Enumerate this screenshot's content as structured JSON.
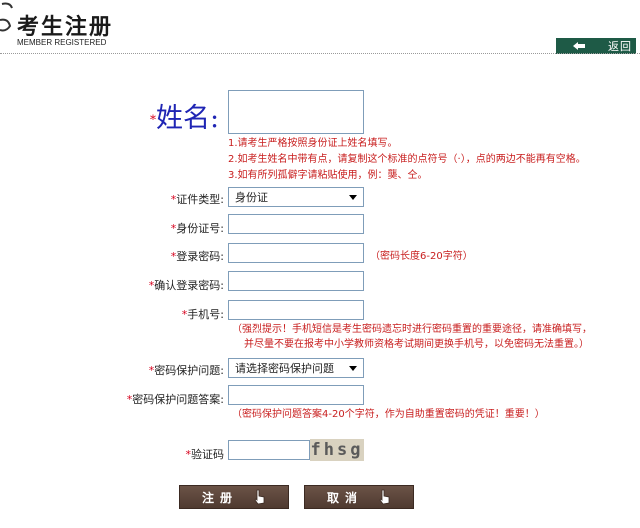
{
  "header": {
    "title": "考生注册",
    "subtitle": "MEMBER REGISTERED",
    "back_label": "返回"
  },
  "form": {
    "required_mark": "*",
    "name_label": "姓名:",
    "name_notes": [
      "1.请考生严格按照身份证上姓名填写。",
      "2.如考生姓名中带有点，请复制这个标准的点符号（·），点的两边不能再有空格。",
      "3.如有所列孤僻字请粘贴使用，例：龑、仝。"
    ],
    "id_type_label": "证件类型:",
    "id_type_value": "身份证",
    "id_number_label": "身份证号:",
    "password_label": "登录密码:",
    "password_hint": "（密码长度6-20字符）",
    "confirm_password_label": "确认登录密码:",
    "phone_label": "手机号:",
    "phone_hint_line1": "（强烈提示！手机短信是考生密码遗忘时进行密码重置的重要途径，请准确填写，",
    "phone_hint_line2": "并尽量不要在报考中小学教师资格考试期间更换手机号，以免密码无法重置。）",
    "security_question_label": "密码保护问题:",
    "security_question_value": "请选择密码保护问题",
    "security_answer_label": "密码保护问题答案:",
    "security_answer_hint": "（密码保护问题答案4-20个字符，作为自助重置密码的凭证！重要！）",
    "captcha_label": "验证码",
    "captcha_text": "fhsg",
    "submit_label": "注册",
    "cancel_label": "取消"
  },
  "colors": {
    "accent_green": "#1e5a46",
    "button_brown": "#5a4338",
    "required_red": "#d6001c",
    "hint_red": "#c81e1e",
    "name_blue": "#1f25b4"
  }
}
